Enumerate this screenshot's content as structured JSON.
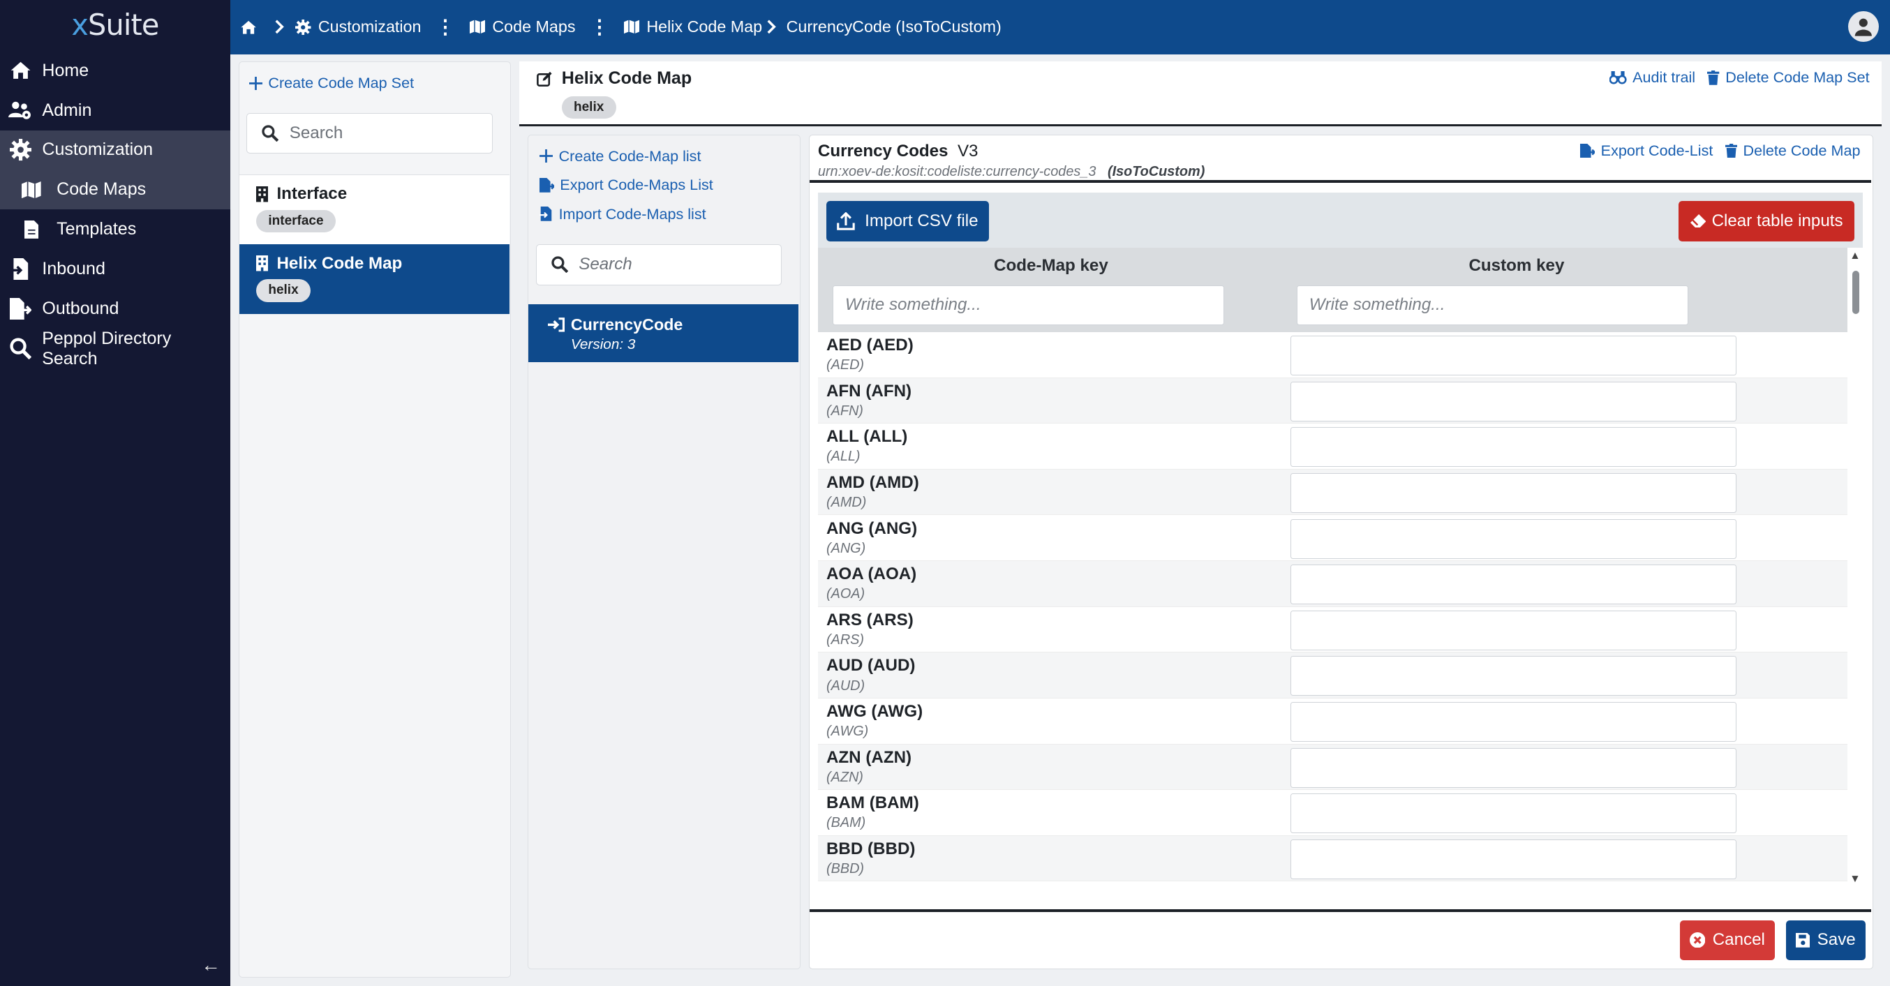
{
  "app": {
    "logo_prefix": "x",
    "logo_suffix": "Suite"
  },
  "sidebar": {
    "items": [
      {
        "label": "Home",
        "icon": "home-icon"
      },
      {
        "label": "Admin",
        "icon": "users-cog-icon"
      },
      {
        "label": "Customization",
        "icon": "gear-icon"
      },
      {
        "label": "Code Maps",
        "icon": "map-icon"
      },
      {
        "label": "Templates",
        "icon": "file-icon"
      },
      {
        "label": "Inbound",
        "icon": "file-import-icon"
      },
      {
        "label": "Outbound",
        "icon": "file-export-icon"
      },
      {
        "label": "Peppol Directory Search",
        "icon": "search-icon"
      }
    ],
    "collapse_label": "←"
  },
  "breadcrumb": {
    "customization": "Customization",
    "code_maps": "Code Maps",
    "code_map": "Helix Code Map",
    "current": "CurrencyCode (IsoToCustom)"
  },
  "sets": {
    "create_label": "Create Code Map Set",
    "search_placeholder": "Search",
    "items": [
      {
        "name": "Interface",
        "tag": "interface"
      },
      {
        "name": "Helix Code Map",
        "tag": "helix"
      }
    ]
  },
  "header": {
    "title": "Helix Code Map",
    "tag": "helix",
    "audit_label": "Audit trail",
    "delete_set_label": "Delete Code Map Set"
  },
  "codemaps": {
    "create_label": "Create Code-Map list",
    "export_label": "Export Code-Maps List",
    "import_label": "Import Code-Maps list",
    "search_placeholder": "Search",
    "selected_name": "CurrencyCode",
    "selected_version": "Version: 3"
  },
  "panel": {
    "title": "Currency Codes",
    "version": "V3",
    "urn": "urn:xoev-de:kosit:codeliste:currency-codes_3",
    "direction": "(IsoToCustom)",
    "export_label": "Export Code-List",
    "delete_label": "Delete Code Map",
    "import_csv_label": "Import CSV file",
    "clear_label": "Clear table inputs",
    "col_key": "Code-Map key",
    "col_custom": "Custom key",
    "filter_placeholder": "Write something...",
    "cancel_label": "Cancel",
    "save_label": "Save"
  },
  "rows": [
    {
      "key": "AED (AED)",
      "sub": "(AED)"
    },
    {
      "key": "AFN (AFN)",
      "sub": "(AFN)"
    },
    {
      "key": "ALL (ALL)",
      "sub": "(ALL)"
    },
    {
      "key": "AMD (AMD)",
      "sub": "(AMD)"
    },
    {
      "key": "ANG (ANG)",
      "sub": "(ANG)"
    },
    {
      "key": "AOA (AOA)",
      "sub": "(AOA)"
    },
    {
      "key": "ARS (ARS)",
      "sub": "(ARS)"
    },
    {
      "key": "AUD (AUD)",
      "sub": "(AUD)"
    },
    {
      "key": "AWG (AWG)",
      "sub": "(AWG)"
    },
    {
      "key": "AZN (AZN)",
      "sub": "(AZN)"
    },
    {
      "key": "BAM (BAM)",
      "sub": "(BAM)"
    },
    {
      "key": "BBD (BBD)",
      "sub": "(BBD)"
    }
  ]
}
